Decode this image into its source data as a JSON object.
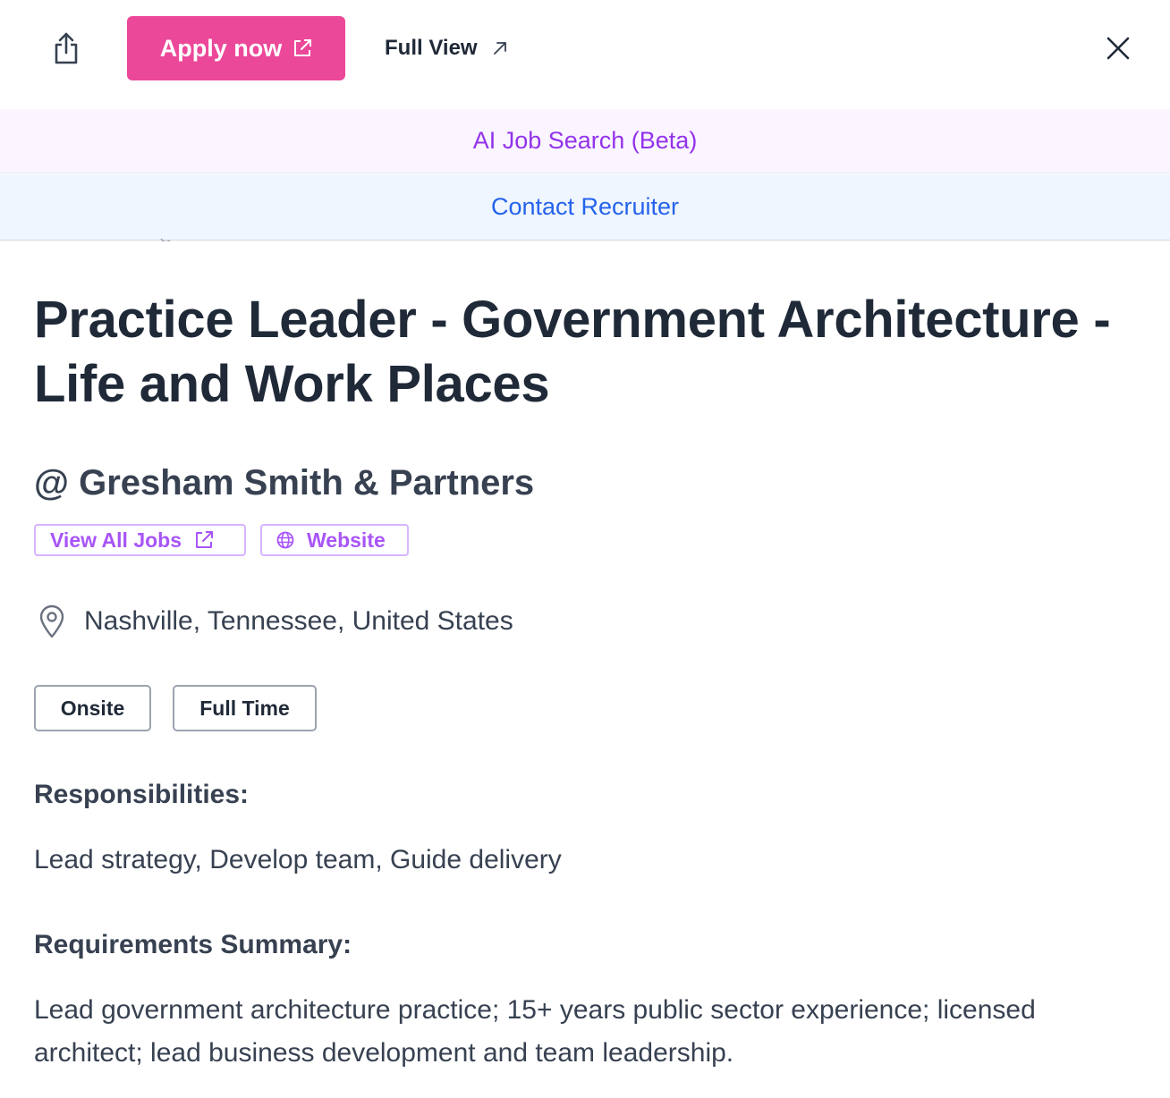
{
  "toolbar": {
    "share_icon": "share-icon",
    "apply_label": "Apply now",
    "apply_icon": "external-link-icon",
    "apply_color": "#ec4899",
    "full_view_label": "Full View",
    "full_view_icon": "arrow-up-right-icon",
    "close_icon": "close-icon"
  },
  "banners": {
    "ai_search_label": "AI Job Search (Beta)",
    "ai_search_color": "#9333ea",
    "contact_recruiter_label": "Contact Recruiter",
    "contact_recruiter_color": "#2563eb"
  },
  "job": {
    "title": "Practice Leader - Government Architecture - Life and Work Places",
    "company": "@ Gresham Smith & Partners",
    "links": {
      "view_all_jobs_label": "View All Jobs",
      "view_all_jobs_icon": "external-link-icon",
      "website_label": "Website",
      "website_icon": "globe-icon",
      "accent_color": "#a855f7"
    },
    "location_icon": "map-pin-icon",
    "location": "Nashville, Tennessee, United States",
    "tags": [
      "Onsite",
      "Full Time"
    ],
    "responsibilities_heading": "Responsibilities:",
    "responsibilities": "Lead strategy, Develop team, Guide delivery",
    "requirements_heading": "Requirements Summary:",
    "requirements": "Lead government architecture practice; 15+ years public sector experience; licensed architect; lead business development and team leadership."
  }
}
